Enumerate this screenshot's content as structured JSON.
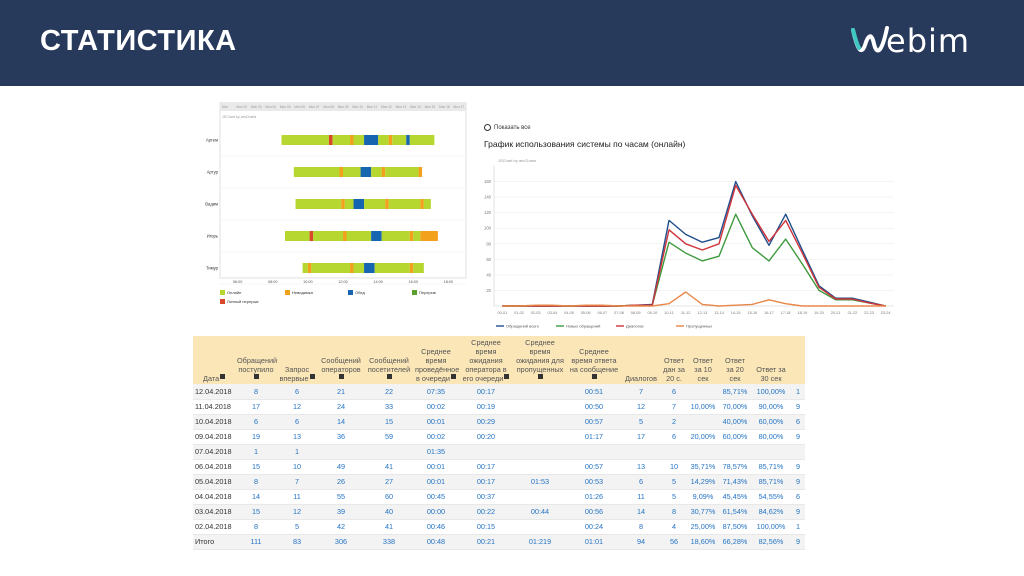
{
  "slide": {
    "title": "СТАТИСТИКА",
    "logo_text": "ebim",
    "logo_mark": "W-wave-logo"
  },
  "colors": {
    "header_bg": "#283a5c",
    "online": "#b6d630",
    "unavailable": "#f2a11d",
    "lunch": "#1565b0",
    "break": "#5aa02c",
    "personal": "#d9482b",
    "table_header_bg": "#fbe6b8",
    "link": "#2574c4"
  },
  "gantt": {
    "credit": "JSChart by amCharts",
    "top_ticks": [
      "Mon",
      "Mon 02",
      "Mon 03",
      "Mon 04",
      "Mon 05",
      "Mon 06",
      "Mon 07",
      "Mon 08",
      "Mon 09",
      "Mon 10",
      "Mon 11",
      "Mon 12",
      "Mon 13",
      "Mon 14",
      "Mon 15",
      "Mon 16",
      "Mon 17"
    ],
    "operators": [
      {
        "name": "Артем",
        "segments": [
          [
            8.5,
            11.2,
            "online"
          ],
          [
            11.2,
            11.4,
            "personal"
          ],
          [
            11.4,
            12.4,
            "online"
          ],
          [
            12.4,
            12.6,
            "unavailable"
          ],
          [
            12.6,
            13.2,
            "online"
          ],
          [
            13.2,
            14.0,
            "lunch"
          ],
          [
            14.0,
            14.6,
            "online"
          ],
          [
            14.6,
            14.8,
            "unavailable"
          ],
          [
            14.8,
            15.6,
            "online"
          ],
          [
            15.6,
            15.8,
            "lunch"
          ],
          [
            15.8,
            17.2,
            "online"
          ]
        ]
      },
      {
        "name": "Артур",
        "segments": [
          [
            9.2,
            11.8,
            "online"
          ],
          [
            11.8,
            12.0,
            "unavailable"
          ],
          [
            12.0,
            13.0,
            "online"
          ],
          [
            13.0,
            13.6,
            "lunch"
          ],
          [
            13.6,
            14.2,
            "online"
          ],
          [
            14.2,
            14.4,
            "unavailable"
          ],
          [
            14.4,
            16.3,
            "online"
          ],
          [
            16.3,
            16.5,
            "unavailable"
          ]
        ]
      },
      {
        "name": "Вадим",
        "segments": [
          [
            9.3,
            11.9,
            "online"
          ],
          [
            11.9,
            12.1,
            "unavailable"
          ],
          [
            12.1,
            12.6,
            "online"
          ],
          [
            12.6,
            13.2,
            "lunch"
          ],
          [
            13.2,
            14.4,
            "online"
          ],
          [
            14.4,
            14.6,
            "unavailable"
          ],
          [
            14.6,
            16.4,
            "online"
          ],
          [
            16.4,
            16.6,
            "unavailable"
          ],
          [
            16.6,
            17.0,
            "online"
          ]
        ]
      },
      {
        "name": "Игорь",
        "segments": [
          [
            8.7,
            10.1,
            "online"
          ],
          [
            10.1,
            10.3,
            "personal"
          ],
          [
            10.3,
            12.0,
            "online"
          ],
          [
            12.0,
            12.2,
            "unavailable"
          ],
          [
            12.2,
            13.6,
            "online"
          ],
          [
            13.6,
            14.2,
            "lunch"
          ],
          [
            14.2,
            15.8,
            "online"
          ],
          [
            15.8,
            16.0,
            "unavailable"
          ],
          [
            16.0,
            16.4,
            "online"
          ],
          [
            16.4,
            17.4,
            "unavailable"
          ]
        ]
      },
      {
        "name": "Тимур",
        "segments": [
          [
            9.7,
            10.0,
            "online"
          ],
          [
            10.0,
            10.2,
            "unavailable"
          ],
          [
            10.2,
            12.4,
            "online"
          ],
          [
            12.4,
            12.6,
            "unavailable"
          ],
          [
            12.6,
            13.2,
            "online"
          ],
          [
            13.2,
            13.8,
            "lunch"
          ],
          [
            13.8,
            15.8,
            "online"
          ],
          [
            15.8,
            16.0,
            "unavailable"
          ],
          [
            16.0,
            16.6,
            "online"
          ]
        ]
      }
    ],
    "x_ticks": [
      "06:00",
      "08:00",
      "10:00",
      "12:00",
      "14:00",
      "16:00",
      "18:00"
    ],
    "legend": [
      {
        "key": "online",
        "label": "Онлайн"
      },
      {
        "key": "unavailable",
        "label": "Невидимка"
      },
      {
        "key": "lunch",
        "label": "Обед"
      },
      {
        "key": "break",
        "label": "Перерыв"
      },
      {
        "key": "personal",
        "label": "Личный перерыв"
      }
    ]
  },
  "chart_data": {
    "type": "line",
    "title": "График использования системы по часам (онлайн)",
    "zoom_label": "Показать все",
    "credit": "JSChart by amCharts",
    "categories": [
      "00-01",
      "01-02",
      "02-03",
      "03-04",
      "04-05",
      "05-06",
      "06-07",
      "07-08",
      "08-09",
      "09-10",
      "10-11",
      "11-12",
      "12-13",
      "13-14",
      "14-15",
      "15-16",
      "16-17",
      "17-18",
      "18-19",
      "19-20",
      "20-21",
      "21-22",
      "22-23",
      "23-24"
    ],
    "ylim": [
      0,
      180
    ],
    "y_ticks": [
      20,
      40,
      60,
      80,
      100,
      120,
      140,
      160
    ],
    "series": [
      {
        "name": "Обращений всего",
        "color": "#1f4e8c",
        "values": [
          0,
          0,
          0,
          0,
          0,
          0,
          0,
          0,
          1,
          2,
          110,
          92,
          82,
          88,
          160,
          116,
          78,
          118,
          72,
          26,
          10,
          10,
          5,
          0
        ]
      },
      {
        "name": "Новых обращений",
        "color": "#3e9a3e",
        "values": [
          0,
          0,
          0,
          0,
          0,
          0,
          0,
          0,
          1,
          1,
          82,
          68,
          58,
          64,
          118,
          75,
          58,
          86,
          54,
          20,
          8,
          8,
          4,
          0
        ]
      },
      {
        "name": "Диалогов",
        "color": "#d0343a",
        "values": [
          0,
          0,
          0,
          0,
          0,
          0,
          0,
          0,
          1,
          1,
          98,
          80,
          72,
          80,
          155,
          118,
          83,
          110,
          68,
          24,
          9,
          9,
          4,
          0
        ]
      },
      {
        "name": "Пропущенных",
        "color": "#e8874a",
        "values": [
          0,
          0,
          1,
          1,
          0,
          1,
          1,
          0,
          0,
          0,
          3,
          18,
          2,
          0,
          1,
          2,
          8,
          3,
          0,
          0,
          0,
          0,
          0,
          0
        ]
      }
    ]
  },
  "table": {
    "headers": [
      "Дата",
      "Обращений поступило",
      "Запрос впервые",
      "Сообщений операторов",
      "Сообщений посетителей",
      "Среднее время проведённое в очереди",
      "Среднее время ожидания оператора в его очереди",
      "Среднее время ожидания для пропущенных",
      "Среднее время ответа на сообщение",
      "Диалогов",
      "Ответ дан за 20 с.",
      "Ответ за 10 сек",
      "Ответ за 20 сек",
      "Ответ за 30 сек",
      ""
    ],
    "rows": [
      [
        "12.04.2018",
        "8",
        "6",
        "21",
        "22",
        "07:35",
        "00:17",
        "",
        "00:51",
        "7",
        "6",
        "",
        "85,71%",
        "100,00%",
        "1"
      ],
      [
        "11.04.2018",
        "17",
        "12",
        "24",
        "33",
        "00:02",
        "00:19",
        "",
        "00:50",
        "12",
        "7",
        "10,00%",
        "70,00%",
        "90,00%",
        "9"
      ],
      [
        "10.04.2018",
        "6",
        "6",
        "14",
        "15",
        "00:01",
        "00:29",
        "",
        "00:57",
        "5",
        "2",
        "",
        "40,00%",
        "60,00%",
        "6"
      ],
      [
        "09.04.2018",
        "19",
        "13",
        "36",
        "59",
        "00:02",
        "00:20",
        "",
        "01:17",
        "17",
        "6",
        "20,00%",
        "60,00%",
        "80,00%",
        "9"
      ],
      [
        "07.04.2018",
        "1",
        "1",
        "",
        "",
        "01:35",
        "",
        "",
        "",
        "",
        "",
        "",
        "",
        "",
        ""
      ],
      [
        "06.04.2018",
        "15",
        "10",
        "49",
        "41",
        "00:01",
        "00:17",
        "",
        "00:57",
        "13",
        "10",
        "35,71%",
        "78,57%",
        "85,71%",
        "9"
      ],
      [
        "05.04.2018",
        "8",
        "7",
        "26",
        "27",
        "00:01",
        "00:17",
        "01:53",
        "00:53",
        "6",
        "5",
        "14,29%",
        "71,43%",
        "85,71%",
        "9"
      ],
      [
        "04.04.2018",
        "14",
        "11",
        "55",
        "60",
        "00:45",
        "00:37",
        "",
        "01:26",
        "11",
        "5",
        "9,09%",
        "45,45%",
        "54,55%",
        "6"
      ],
      [
        "03.04.2018",
        "15",
        "12",
        "39",
        "40",
        "00:00",
        "00:22",
        "00:44",
        "00:56",
        "14",
        "8",
        "30,77%",
        "61,54%",
        "84,62%",
        "9"
      ],
      [
        "02.04.2018",
        "8",
        "5",
        "42",
        "41",
        "00:46",
        "00:15",
        "",
        "00:24",
        "8",
        "4",
        "25,00%",
        "87,50%",
        "100,00%",
        "1"
      ],
      [
        "Итого",
        "111",
        "83",
        "306",
        "338",
        "00:48",
        "00:21",
        "01:219",
        "01:01",
        "94",
        "56",
        "18,60%",
        "66,28%",
        "82,56%",
        "9"
      ]
    ]
  }
}
